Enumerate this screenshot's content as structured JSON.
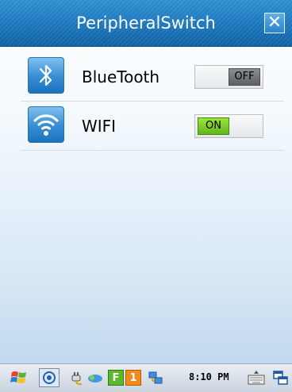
{
  "window": {
    "title": "PeripheralSwitch",
    "close_glyph": "✕"
  },
  "rows": [
    {
      "label": "BlueTooth",
      "icon": "bluetooth-icon",
      "state": "OFF"
    },
    {
      "label": "WIFI",
      "icon": "wifi-icon",
      "state": "ON"
    }
  ],
  "taskbar": {
    "time": "8:10 PM",
    "icons": [
      "windows-start-icon",
      "gps-icon",
      "power-plug-icon",
      "connectivity-icon",
      "f-icon",
      "one-icon",
      "network-icon",
      "keyboard-icon",
      "switch-window-icon"
    ],
    "f_label": "F",
    "one_label": "1"
  },
  "colors": {
    "title_bar": "#1f7abf",
    "on": "#7ccc2a",
    "off": "#6f7174"
  }
}
